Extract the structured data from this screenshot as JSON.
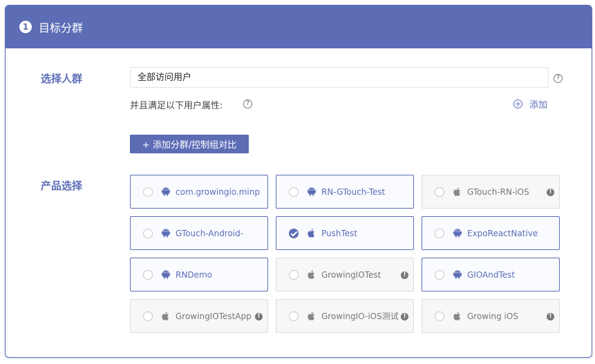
{
  "header": {
    "step": "1",
    "title": "目标分群"
  },
  "audience": {
    "label": "选择人群",
    "value": "全部访问用户",
    "attr_text": "并且满足以下用户属性:",
    "add_label": "添加",
    "add_group_label": "+ 添加分群/控制组对比"
  },
  "products": {
    "label": "产品选择",
    "items": [
      {
        "name": "com.growingio.minp",
        "platform": "android-icon",
        "enabled": true,
        "selected": false
      },
      {
        "name": "RN-GTouch-Test",
        "platform": "android-icon",
        "enabled": true,
        "selected": false
      },
      {
        "name": "GTouch-RN-iOS",
        "platform": "apple-icon",
        "enabled": false,
        "selected": false
      },
      {
        "name": "GTouch-Android-",
        "platform": "android-icon",
        "enabled": true,
        "selected": false
      },
      {
        "name": "PushTest",
        "platform": "apple-icon",
        "enabled": true,
        "selected": true
      },
      {
        "name": "ExpoReactNative",
        "platform": "android-icon",
        "enabled": true,
        "selected": false
      },
      {
        "name": "RNDemo",
        "platform": "android-icon",
        "enabled": true,
        "selected": false
      },
      {
        "name": "GrowingIOTest",
        "platform": "apple-icon",
        "enabled": false,
        "selected": false
      },
      {
        "name": "GIOAndTest",
        "platform": "android-icon",
        "enabled": true,
        "selected": false
      },
      {
        "name": "GrowingIOTestApp",
        "platform": "apple-icon",
        "enabled": false,
        "selected": false
      },
      {
        "name": "GrowingIO-iOS测试",
        "platform": "apple-icon",
        "enabled": false,
        "selected": false
      },
      {
        "name": "Growing iOS",
        "platform": "apple-icon",
        "enabled": false,
        "selected": false
      }
    ]
  },
  "colors": {
    "accent": "#5c6db6",
    "disabled_text": "#777777",
    "disabled_bg": "#f7f7f7"
  }
}
